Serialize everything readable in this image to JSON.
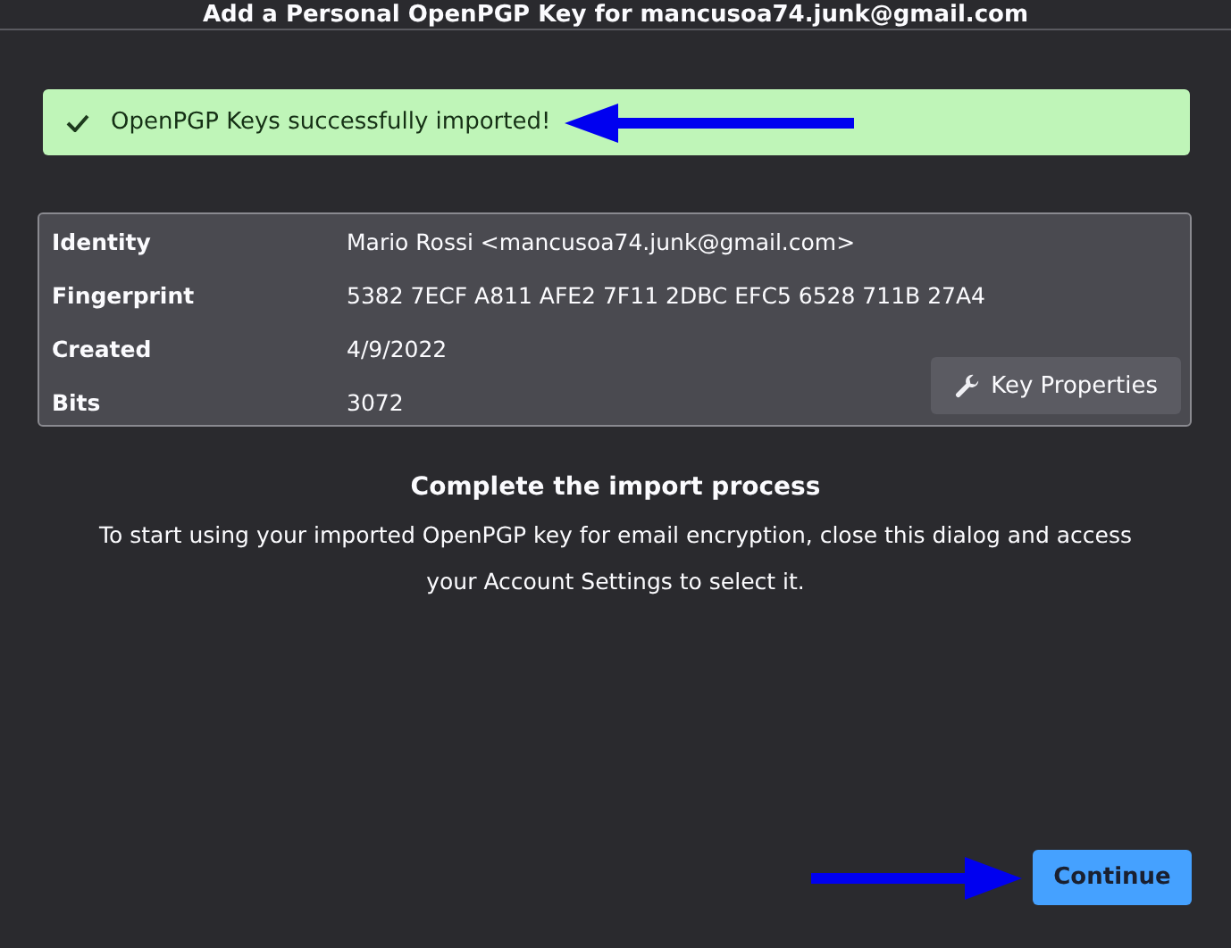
{
  "window": {
    "title": "Add a Personal OpenPGP Key for mancusoa74.junk@gmail.com"
  },
  "notification": {
    "message": "OpenPGP Keys successfully imported!"
  },
  "key_details": [
    {
      "label": "Identity",
      "value": "Mario Rossi <mancusoa74.junk@gmail.com>"
    },
    {
      "label": "Fingerprint",
      "value": "5382 7ECF A811 AFE2 7F11 2DBC EFC5 6528 711B 27A4"
    },
    {
      "label": "Created",
      "value": "4/9/2022"
    },
    {
      "label": "Bits",
      "value": "3072"
    }
  ],
  "key_properties_button": "Key Properties",
  "heading": "Complete the import process",
  "description": "To start using your imported OpenPGP key for email encryption, close this dialog and access your Account Settings to select it.",
  "buttons": [
    "Continue"
  ]
}
